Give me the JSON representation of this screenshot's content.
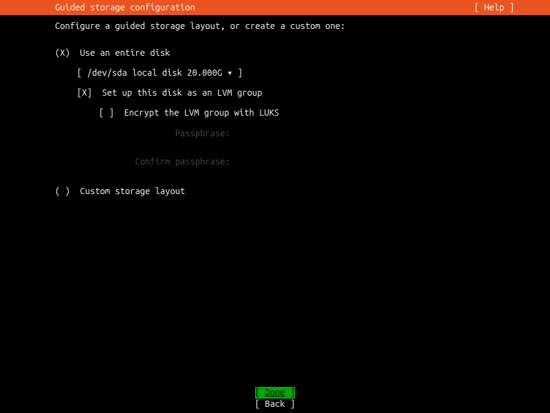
{
  "header": {
    "title": "Guided storage configuration",
    "help": "[ Help ]"
  },
  "content": {
    "intro": "Configure a guided storage layout, or create a custom one:",
    "entire_disk": {
      "radio": "(X)",
      "label": "Use an entire disk"
    },
    "disk_selector": {
      "open": "[ ",
      "value": "/dev/sda local disk 20.000G",
      "arrow": " ▾ ",
      "close": "]"
    },
    "lvm": {
      "checkbox": "[X]",
      "label": "Set up this disk as an LVM group"
    },
    "luks": {
      "checkbox": "[ ]",
      "label": "Encrypt the LVM group with LUKS"
    },
    "passphrase": {
      "label": "Passphrase:"
    },
    "confirm_passphrase": {
      "label": "Confirm passphrase:"
    },
    "custom": {
      "radio": "( )",
      "label": "Custom storage layout"
    }
  },
  "footer": {
    "done_open": "[ ",
    "done_label": "Done",
    "done_close": "      ]",
    "back_open": "[ ",
    "back_label": "Back",
    "back_close": "      ]"
  }
}
